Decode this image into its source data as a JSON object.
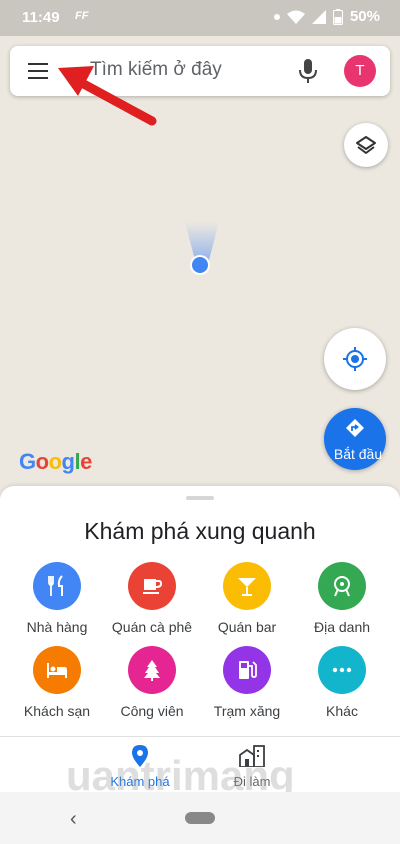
{
  "status": {
    "time": "11:49",
    "carrier": "FF",
    "battery": "50%"
  },
  "search": {
    "placeholder": "Tìm kiếm ở đây",
    "avatar_letter": "T"
  },
  "map": {
    "brand": [
      "G",
      "o",
      "o",
      "g",
      "l",
      "e"
    ],
    "start_label": "Bắt đầu"
  },
  "explore": {
    "title": "Khám phá xung quanh",
    "categories": [
      {
        "label": "Nhà hàng",
        "icon": "restaurant-icon",
        "color": "#4285f4"
      },
      {
        "label": "Quán cà phê",
        "icon": "coffee-icon",
        "color": "#ea4335"
      },
      {
        "label": "Quán bar",
        "icon": "bar-icon",
        "color": "#fbbc04"
      },
      {
        "label": "Địa danh",
        "icon": "landmark-icon",
        "color": "#34a853"
      },
      {
        "label": "Khách sạn",
        "icon": "hotel-icon",
        "color": "#f57c00"
      },
      {
        "label": "Công viên",
        "icon": "park-icon",
        "color": "#e52592"
      },
      {
        "label": "Trạm xăng",
        "icon": "gas-station-icon",
        "color": "#9334e6"
      },
      {
        "label": "Khác",
        "icon": "more-icon",
        "color": "#12b5cb"
      }
    ]
  },
  "nav": {
    "explore": "Khám phá",
    "commute": "Đi làm"
  },
  "watermark": "uantrimang",
  "colors": {
    "accent": "#1a73e8",
    "arrow": "#e02020"
  }
}
